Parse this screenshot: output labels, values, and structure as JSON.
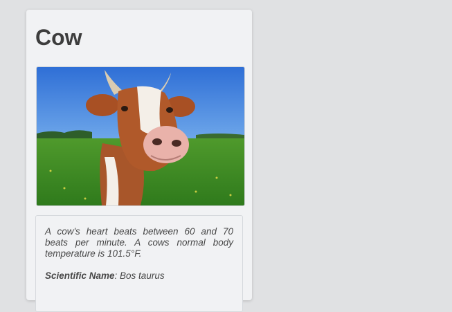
{
  "card": {
    "title": "Cow",
    "image_alt": "cow",
    "fact": "A cow's heart beats between 60 and 70 beats per minute. A cows normal body temperature is 101.5°F.",
    "scientific_name_label": "Scientific Name",
    "scientific_name_value": ": Bos taurus"
  },
  "colors": {
    "page_background": "#e0e1e3",
    "card_background": "#f1f2f4",
    "text": "#3d3d3d"
  }
}
